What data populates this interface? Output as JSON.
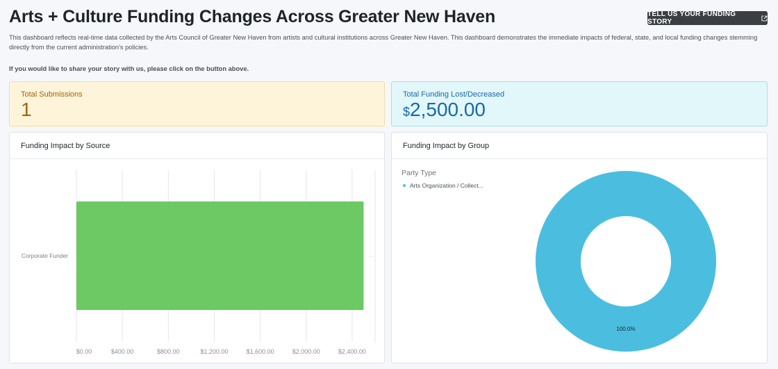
{
  "header": {
    "title": "Arts + Culture Funding Changes Across Greater New Haven",
    "story_button_label": "TELL US YOUR FUNDING STORY",
    "description": "This dashboard reflects real-time data collected by the Arts Council of Greater New Haven from artists and cultural institutions across Greater New Haven. This dashboard demonstrates the immediate impacts of federal, state, and local funding changes stemming directly from the current administration's policies.",
    "cta_note": "If you would like to share your story with us, please click on the button above."
  },
  "kpis": {
    "submissions_label": "Total Submissions",
    "submissions_value": "1",
    "funding_label": "Total Funding Lost/Decreased",
    "funding_currency": "$",
    "funding_value": "2,500.00"
  },
  "colors": {
    "bar": "#6cc964",
    "donut": "#4bbee0"
  },
  "chart_data": [
    {
      "type": "bar",
      "orientation": "horizontal",
      "title": "Funding Impact by Source",
      "categories": [
        "Corporate Funder"
      ],
      "values": [
        2500
      ],
      "xlim": [
        0,
        2600
      ],
      "x_ticks": [
        0,
        400,
        800,
        1200,
        1600,
        2000,
        2400
      ],
      "x_tick_labels": [
        "$0.00",
        "$400.00",
        "$800.00",
        "$1,200.00",
        "$1,600.00",
        "$2,000.00",
        "$2,400.00"
      ],
      "grid": true,
      "bar_end_label": "..."
    },
    {
      "type": "pie",
      "style": "donut",
      "title": "Funding Impact by Group",
      "legend_title": "Party Type",
      "legend_position": "top-left",
      "categories": [
        "Arts Organization / Collect..."
      ],
      "values": [
        100
      ],
      "slice_labels": [
        "100.0%"
      ]
    }
  ]
}
